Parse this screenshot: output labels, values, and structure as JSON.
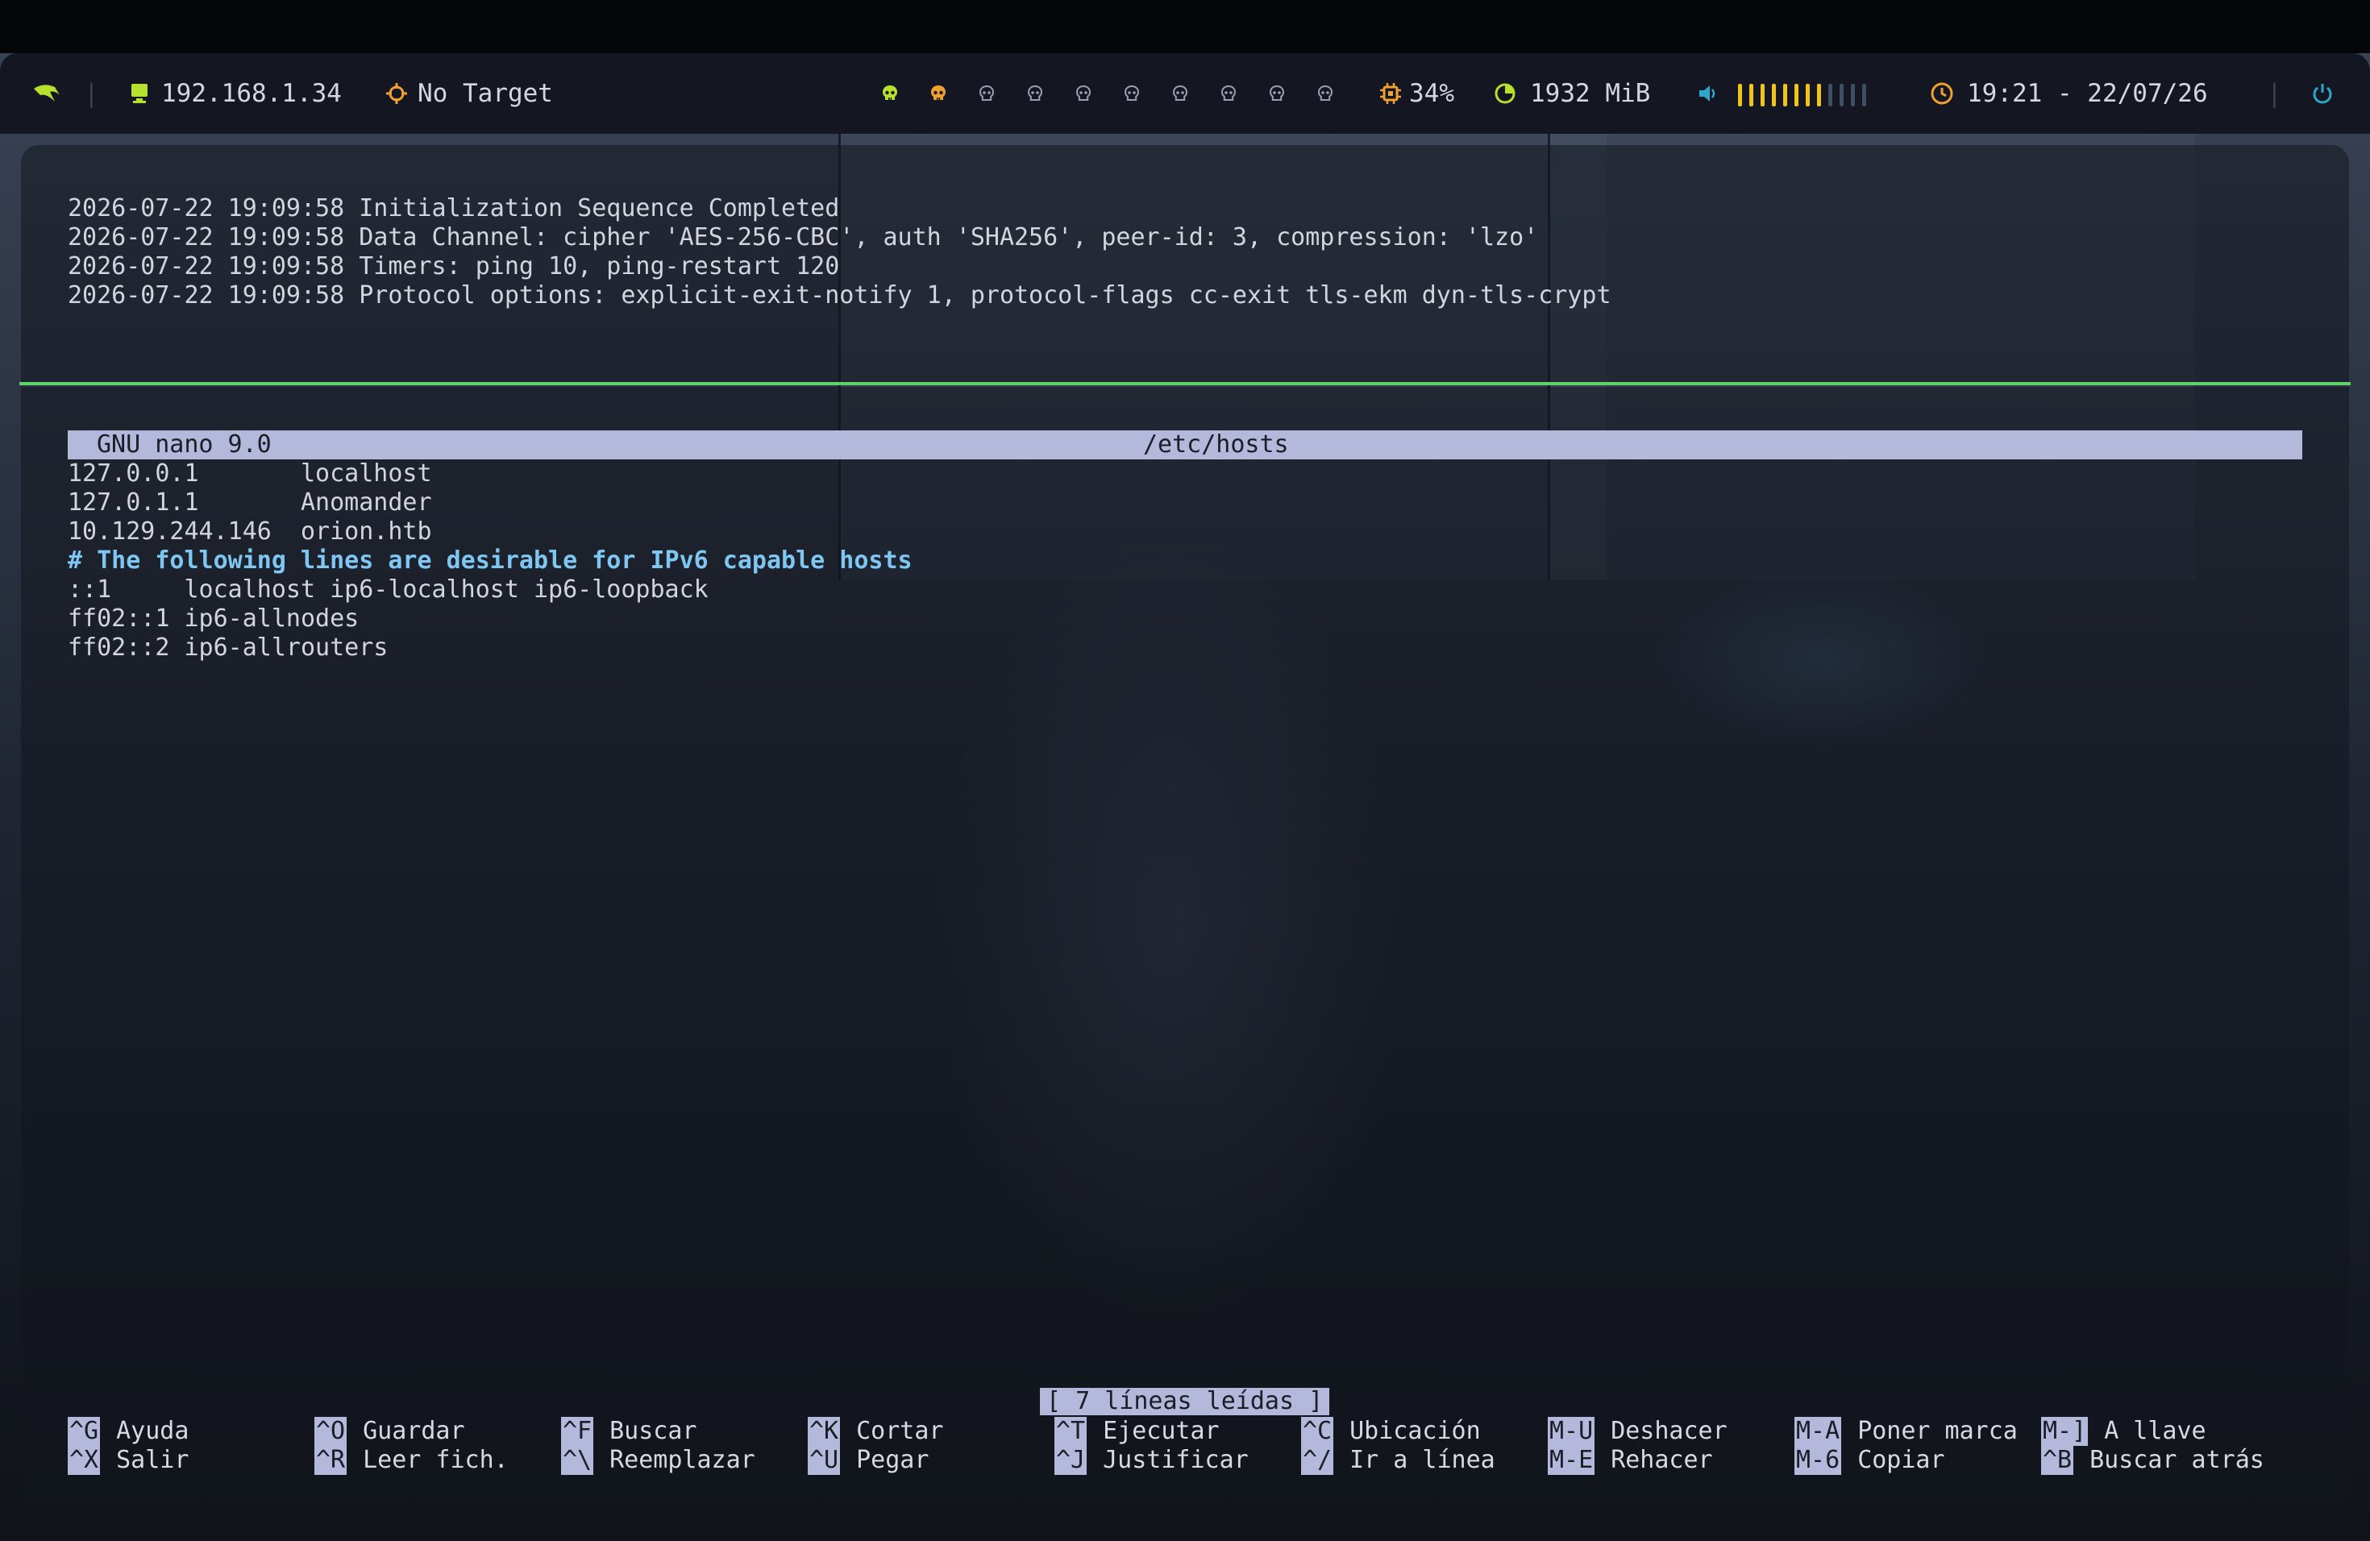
{
  "topbar": {
    "ip": "192.168.1.34",
    "target": "No Target",
    "cpu": "34%",
    "memory": "1932 MiB",
    "volume_level": 0.67,
    "clock": "19:21 - 22/07/26",
    "colors": {
      "accent_green": "#b8e02e",
      "accent_orange": "#f0a030",
      "power": "#2aa7c9"
    }
  },
  "workspaces": [
    {
      "icon": "skull-filled-icon",
      "state": "active"
    },
    {
      "icon": "skull-filled-icon",
      "state": "occupied"
    },
    {
      "icon": "skull-outline-icon",
      "state": "empty"
    },
    {
      "icon": "skull-outline-icon",
      "state": "empty"
    },
    {
      "icon": "skull-outline-icon",
      "state": "empty"
    },
    {
      "icon": "skull-outline-icon",
      "state": "empty"
    },
    {
      "icon": "skull-outline-icon",
      "state": "empty"
    },
    {
      "icon": "skull-outline-icon",
      "state": "empty"
    },
    {
      "icon": "skull-outline-icon",
      "state": "empty"
    },
    {
      "icon": "skull-outline-icon",
      "state": "empty"
    }
  ],
  "log": [
    "2026-07-22 19:09:58 Initialization Sequence Completed",
    "2026-07-22 19:09:58 Data Channel: cipher 'AES-256-CBC', auth 'SHA256', peer-id: 3, compression: 'lzo'",
    "2026-07-22 19:09:58 Timers: ping 10, ping-restart 120",
    "2026-07-22 19:09:58 Protocol options: explicit-exit-notify 1, protocol-flags cc-exit tls-ekm dyn-tls-crypt"
  ],
  "nano": {
    "version": "GNU nano 9.0",
    "filename": "/etc/hosts",
    "lines": [
      "127.0.0.1       localhost",
      "127.0.1.1       Anomander",
      "10.129.244.146  orion.htb",
      "# The following lines are desirable for IPv6 capable hosts",
      "::1     localhost ip6-localhost ip6-loopback",
      "ff02::1 ip6-allnodes",
      "ff02::2 ip6-allrouters"
    ],
    "status": "[ 7 líneas leídas ]",
    "shortcuts": [
      {
        "key": "^G",
        "label": "Ayuda"
      },
      {
        "key": "^X",
        "label": "Salir"
      },
      {
        "key": "^O",
        "label": "Guardar"
      },
      {
        "key": "^R",
        "label": "Leer fich."
      },
      {
        "key": "^F",
        "label": "Buscar"
      },
      {
        "key": "^\\",
        "label": "Reemplazar"
      },
      {
        "key": "^K",
        "label": "Cortar"
      },
      {
        "key": "^U",
        "label": "Pegar"
      },
      {
        "key": "^T",
        "label": "Ejecutar"
      },
      {
        "key": "^J",
        "label": "Justificar"
      },
      {
        "key": "^C",
        "label": "Ubicación"
      },
      {
        "key": "^/",
        "label": "Ir a línea"
      },
      {
        "key": "M-U",
        "label": "Deshacer"
      },
      {
        "key": "M-E",
        "label": "Rehacer"
      },
      {
        "key": "M-A",
        "label": "Poner marca"
      },
      {
        "key": "M-6",
        "label": "Copiar"
      },
      {
        "key": "M-]",
        "label": "A llave"
      },
      {
        "key": "^B",
        "label": "Buscar atrás"
      }
    ]
  }
}
